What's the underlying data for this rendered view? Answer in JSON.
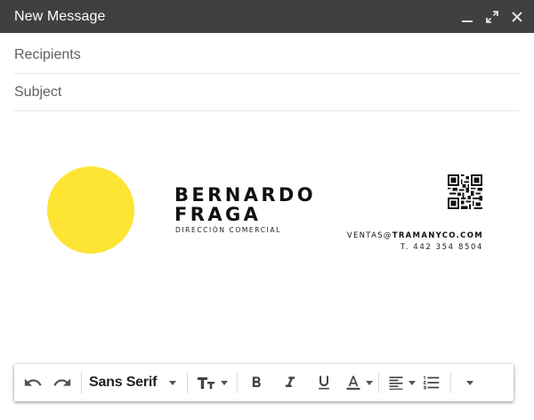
{
  "window": {
    "title": "New Message",
    "controls": [
      "minimize-icon",
      "expand-icon",
      "close-icon"
    ]
  },
  "fields": {
    "recipients_placeholder": "Recipients",
    "subject_placeholder": "Subject"
  },
  "signature": {
    "name_line1": "BERNARDO",
    "name_line2": "FRAGA",
    "role": "DIRECCIÓN COMERCIAL",
    "email_user": "VENTAS@",
    "email_domain": "TRAMANYCO.COM",
    "phone": "T. 442 354 8504",
    "circle_color": "#fee433"
  },
  "toolbar": {
    "font_family": "Sans Serif",
    "icons": [
      "undo-icon",
      "redo-icon",
      "text-size-icon",
      "bold-icon",
      "italic-icon",
      "underline-icon",
      "text-color-icon",
      "align-icon",
      "numbered-list-icon",
      "more-options-icon"
    ]
  },
  "colors": {
    "titlebar_bg": "#404040",
    "accent_yellow": "#fee433"
  }
}
